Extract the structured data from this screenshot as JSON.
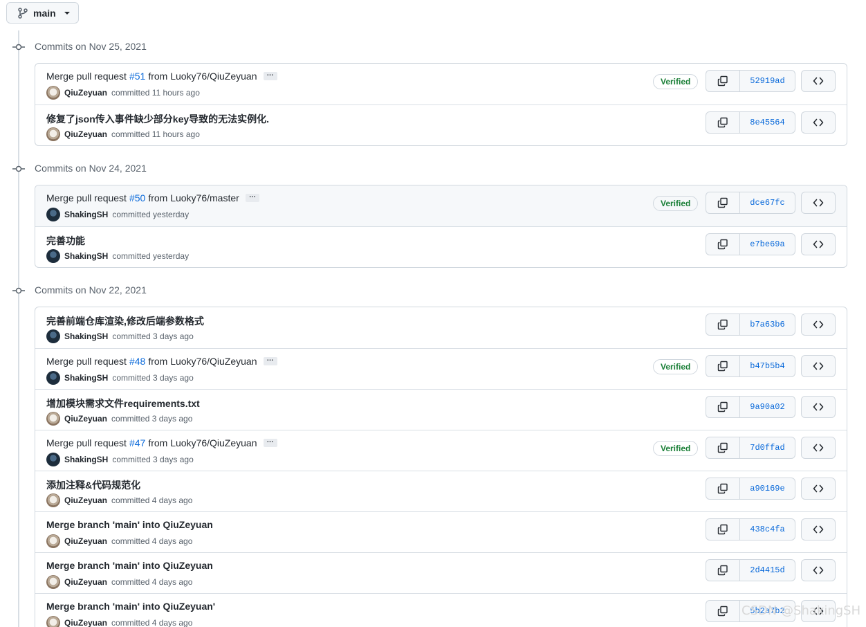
{
  "branch": {
    "label": "main"
  },
  "groups": [
    {
      "date_label": "Commits on Nov 25, 2021",
      "commits": [
        {
          "msg_pre": "Merge pull request",
          "pr": "#51",
          "msg_rest": "from Luoky76/QiuZeyuan",
          "title": "",
          "author": "QiuZeyuan",
          "when": "committed 11 hours ago",
          "verified": "Verified",
          "sha": "52919ad",
          "avatar": "dog"
        },
        {
          "msg_pre": "",
          "pr": "",
          "msg_rest": "",
          "title": "修复了json传入事件缺少部分key导致的无法实例化.",
          "author": "QiuZeyuan",
          "when": "committed 11 hours ago",
          "verified": "",
          "sha": "8e45564",
          "avatar": "dog"
        }
      ]
    },
    {
      "date_label": "Commits on Nov 24, 2021",
      "commits": [
        {
          "msg_pre": "Merge pull request",
          "pr": "#50",
          "msg_rest": "from Luoky76/master",
          "title": "",
          "author": "ShakingSH",
          "when": "committed yesterday",
          "verified": "Verified",
          "sha": "dce67fc",
          "avatar": "dark"
        },
        {
          "msg_pre": "",
          "pr": "",
          "msg_rest": "",
          "title": "完善功能",
          "author": "ShakingSH",
          "when": "committed yesterday",
          "verified": "",
          "sha": "e7be69a",
          "avatar": "dark"
        }
      ]
    },
    {
      "date_label": "Commits on Nov 22, 2021",
      "commits": [
        {
          "msg_pre": "",
          "pr": "",
          "msg_rest": "",
          "title": "完善前端仓库渲染,修改后端参数格式",
          "author": "ShakingSH",
          "when": "committed 3 days ago",
          "verified": "",
          "sha": "b7a63b6",
          "avatar": "dark"
        },
        {
          "msg_pre": "Merge pull request",
          "pr": "#48",
          "msg_rest": "from Luoky76/QiuZeyuan",
          "title": "",
          "author": "ShakingSH",
          "when": "committed 3 days ago",
          "verified": "Verified",
          "sha": "b47b5b4",
          "avatar": "dark"
        },
        {
          "msg_pre": "",
          "pr": "",
          "msg_rest": "",
          "title": "增加模块需求文件requirements.txt",
          "author": "QiuZeyuan",
          "when": "committed 3 days ago",
          "verified": "",
          "sha": "9a90a02",
          "avatar": "dog"
        },
        {
          "msg_pre": "Merge pull request",
          "pr": "#47",
          "msg_rest": "from Luoky76/QiuZeyuan",
          "title": "",
          "author": "ShakingSH",
          "when": "committed 3 days ago",
          "verified": "Verified",
          "sha": "7d0ffad",
          "avatar": "dark"
        },
        {
          "msg_pre": "",
          "pr": "",
          "msg_rest": "",
          "title": "添加注释&代码规范化",
          "author": "QiuZeyuan",
          "when": "committed 4 days ago",
          "verified": "",
          "sha": "a90169e",
          "avatar": "dog"
        },
        {
          "msg_pre": "",
          "pr": "",
          "msg_rest": "",
          "title": "Merge branch 'main' into QiuZeyuan",
          "author": "QiuZeyuan",
          "when": "committed 4 days ago",
          "verified": "",
          "sha": "438c4fa",
          "avatar": "dog"
        },
        {
          "msg_pre": "",
          "pr": "",
          "msg_rest": "",
          "title": "Merge branch 'main' into QiuZeyuan",
          "author": "QiuZeyuan",
          "when": "committed 4 days ago",
          "verified": "",
          "sha": "2d4415d",
          "avatar": "dog"
        },
        {
          "msg_pre": "",
          "pr": "",
          "msg_rest": "",
          "title": "Merge branch 'main' into QiuZeyuan'",
          "author": "QiuZeyuan",
          "when": "committed 4 days ago",
          "verified": "",
          "sha": "5b2a7b2",
          "avatar": "dog"
        }
      ]
    }
  ],
  "watermark": "CSDN @ShakingSH",
  "icons": {
    "branch": "git-branch-icon",
    "commit_node": "git-commit-icon",
    "copy": "copy-icon",
    "browse": "code-icon"
  }
}
